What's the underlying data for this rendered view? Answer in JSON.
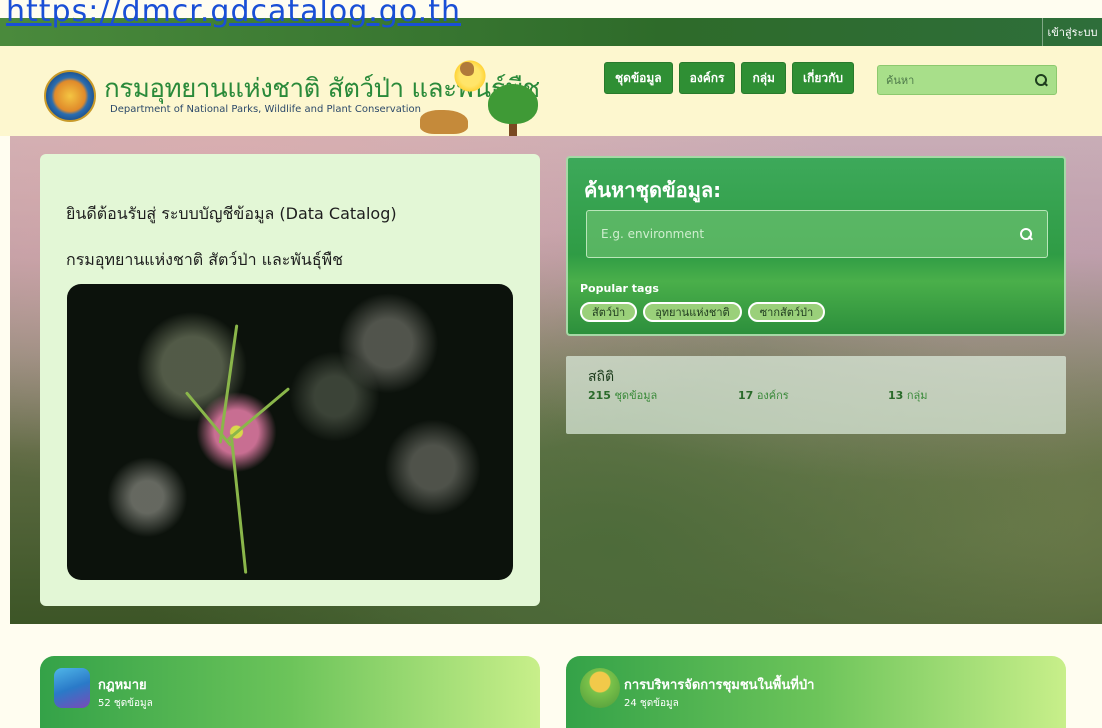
{
  "url_overlay": "https://dmcr.gdcatalog.go.th",
  "topbar": {
    "login_label": "เข้าสู่ระบบ"
  },
  "header": {
    "title_th": "กรมอุทยานแห่งชาติ สัตว์ป่า และพันธุ์พืช",
    "title_en": "Department of National Parks, Wildlife and Plant Conservation",
    "nav": [
      "ชุดข้อมูล",
      "องค์กร",
      "กลุ่ม",
      "เกี่ยวกับ"
    ],
    "search_placeholder": "ค้นหา"
  },
  "welcome": {
    "line1": "ยินดีต้อนรับสู่ ระบบบัญชีข้อมูล (Data Catalog)",
    "line2": "กรมอุทยานแห่งชาติ สัตว์ป่า และพันธุ์พืช"
  },
  "dataset_search": {
    "title": "ค้นหาชุดข้อมูล:",
    "placeholder": "E.g. environment",
    "popular_label": "Popular tags",
    "tags": [
      "สัตว์ป่า",
      "อุทยานแห่งชาติ",
      "ซากสัตว์ป่า"
    ]
  },
  "stats": {
    "title": "สถิติ",
    "items": [
      {
        "value": "215",
        "label": "ชุดข้อมูล"
      },
      {
        "value": "17",
        "label": "องค์กร"
      },
      {
        "value": "13",
        "label": "กลุ่ม"
      }
    ]
  },
  "categories": [
    {
      "title": "กฎหมาย",
      "count": "52 ชุดข้อมูล",
      "icon": "law-book-icon"
    },
    {
      "title": "การบริหารจัดการชุมชนในพื้นที่ป่า",
      "count": "24 ชุดข้อมูล",
      "icon": "village-community-icon"
    }
  ],
  "colors": {
    "primary_green": "#2f8f34",
    "header_bg": "#fdf7cf",
    "topbar": "#2e6b2a"
  }
}
